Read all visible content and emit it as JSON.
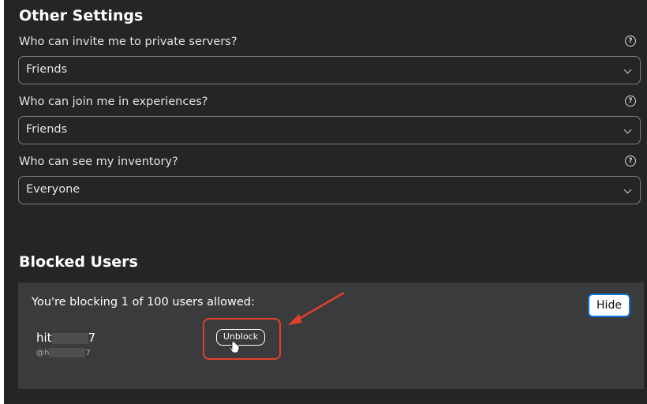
{
  "other_settings": {
    "title": "Other Settings",
    "items": [
      {
        "label": "Who can invite me to private servers?",
        "value": "Friends"
      },
      {
        "label": "Who can join me in experiences?",
        "value": "Friends"
      },
      {
        "label": "Who can see my inventory?",
        "value": "Everyone"
      }
    ],
    "help_glyph": "?"
  },
  "blocked_users": {
    "title": "Blocked Users",
    "count_text": "You're blocking 1 of 100 users allowed:",
    "hide_label": "Hide",
    "users": [
      {
        "name_prefix": "hit",
        "name_suffix": "7",
        "handle_prefix": "@h",
        "handle_suffix": "7",
        "unblock_label": "Unblock"
      }
    ]
  },
  "colors": {
    "background": "#232527",
    "blocked_box": "#393b3d",
    "annotation": "#e0402a",
    "hide_border": "#0a74da"
  },
  "icons": [
    "help-icon",
    "chevron-down-icon",
    "hand-cursor-icon",
    "annotation-arrow"
  ]
}
